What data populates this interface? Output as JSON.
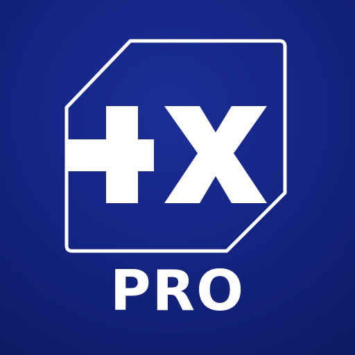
{
  "app_icon": {
    "badge_text": "PRO",
    "logo_text": "+x",
    "colors": {
      "background": "#142585",
      "background_dark": "#0d1a63",
      "foreground": "#ffffff"
    }
  }
}
